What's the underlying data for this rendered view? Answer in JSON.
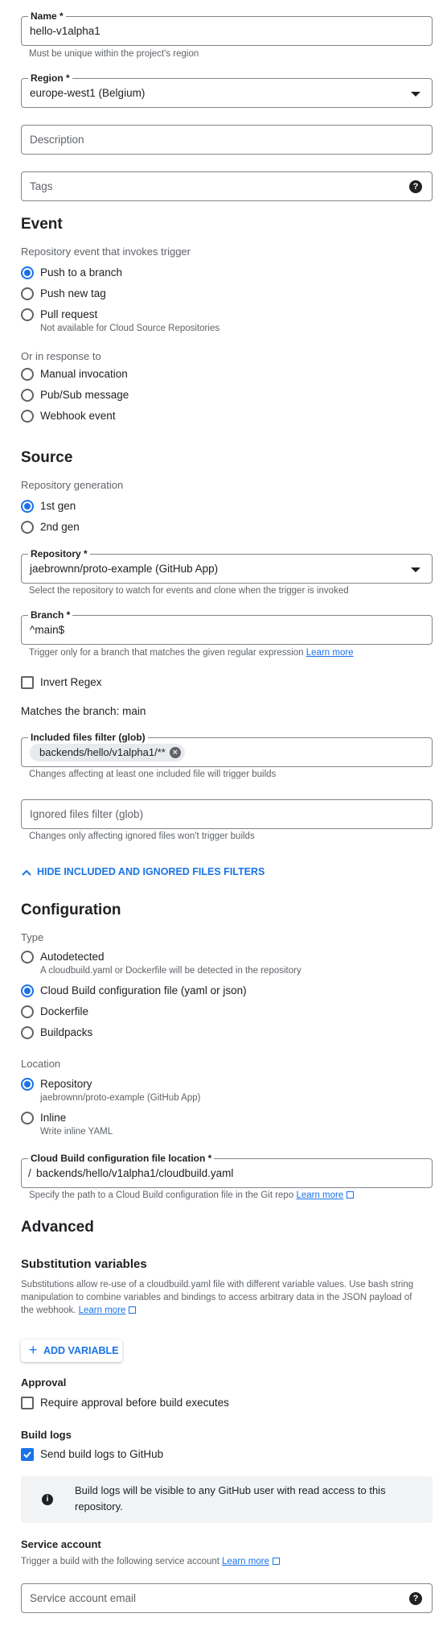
{
  "basics": {
    "name_label": "Name *",
    "name_value": "hello-v1alpha1",
    "name_hint": "Must be unique within the project's region",
    "region_label": "Region *",
    "region_value": "europe-west1 (Belgium)",
    "description_placeholder": "Description",
    "tags_placeholder": "Tags"
  },
  "event": {
    "title": "Event",
    "subtitle": "Repository event that invokes trigger",
    "options": [
      {
        "label": "Push to a branch",
        "selected": true
      },
      {
        "label": "Push new tag",
        "selected": false
      },
      {
        "label": "Pull request",
        "selected": false,
        "note": "Not available for Cloud Source Repositories"
      }
    ],
    "response_subtitle": "Or in response to",
    "response_options": [
      {
        "label": "Manual invocation",
        "selected": false
      },
      {
        "label": "Pub/Sub message",
        "selected": false
      },
      {
        "label": "Webhook event",
        "selected": false
      }
    ]
  },
  "source": {
    "title": "Source",
    "generation_subtitle": "Repository generation",
    "generation_options": [
      {
        "label": "1st gen",
        "selected": true
      },
      {
        "label": "2nd gen",
        "selected": false
      }
    ],
    "repository_label": "Repository *",
    "repository_value": "jaebrownn/proto-example (GitHub App)",
    "repository_hint": "Select the repository to watch for events and clone when the trigger is invoked",
    "branch_label": "Branch *",
    "branch_value": "^main$",
    "branch_hint": "Trigger only for a branch that matches the given regular expression",
    "branch_hint_link": "Learn more",
    "invert_regex_label": "Invert Regex",
    "invert_regex_checked": false,
    "matches_text": "Matches the branch: main",
    "included_label": "Included files filter (glob)",
    "included_chip": "backends/hello/v1alpha1/**",
    "included_hint": "Changes affecting at least one included file will trigger builds",
    "ignored_placeholder": "Ignored files filter (glob)",
    "ignored_hint": "Changes only affecting ignored files won't trigger builds",
    "toggle_filters_label": "HIDE INCLUDED AND IGNORED FILES FILTERS"
  },
  "configuration": {
    "title": "Configuration",
    "type_subtitle": "Type",
    "type_options": [
      {
        "label": "Autodetected",
        "selected": false,
        "note": "A cloudbuild.yaml or Dockerfile will be detected in the repository"
      },
      {
        "label": "Cloud Build configuration file (yaml or json)",
        "selected": true
      },
      {
        "label": "Dockerfile",
        "selected": false
      },
      {
        "label": "Buildpacks",
        "selected": false
      }
    ],
    "location_subtitle": "Location",
    "location_options": [
      {
        "label": "Repository",
        "selected": true,
        "note": "jaebrownn/proto-example (GitHub App)"
      },
      {
        "label": "Inline",
        "selected": false,
        "note": "Write inline YAML"
      }
    ],
    "file_location_label": "Cloud Build configuration file location *",
    "file_location_prefix": "/",
    "file_location_value": "backends/hello/v1alpha1/cloudbuild.yaml",
    "file_location_hint": "Specify the path to a Cloud Build configuration file in the Git repo",
    "file_location_link": "Learn more"
  },
  "advanced": {
    "title": "Advanced",
    "substitution_title": "Substitution variables",
    "substitution_line1": "Substitutions allow re-use of a cloudbuild.yaml file with different variable values. Use bash string",
    "substitution_line2": "manipulation to combine variables and bindings to access arbitrary data in the JSON payload of",
    "substitution_line3": "the webhook.",
    "substitution_link": "Learn more",
    "add_variable_label": "ADD VARIABLE",
    "approval_title": "Approval",
    "approval_label": "Require approval before build executes",
    "approval_checked": false,
    "build_logs_title": "Build logs",
    "build_logs_label": "Send build logs to GitHub",
    "build_logs_checked": true,
    "info_line1": "Build logs will be visible to any GitHub user with read access to this",
    "info_line2": "repository.",
    "service_account_title": "Service account",
    "service_account_hint": "Trigger a build with the following service account",
    "service_account_link": "Learn more",
    "service_account_placeholder": "Service account email"
  },
  "colors": {
    "accent": "#1a73e8",
    "text": "#202124",
    "muted": "#5f6368",
    "border": "#80868b",
    "info_bg": "#f1f3f4"
  }
}
